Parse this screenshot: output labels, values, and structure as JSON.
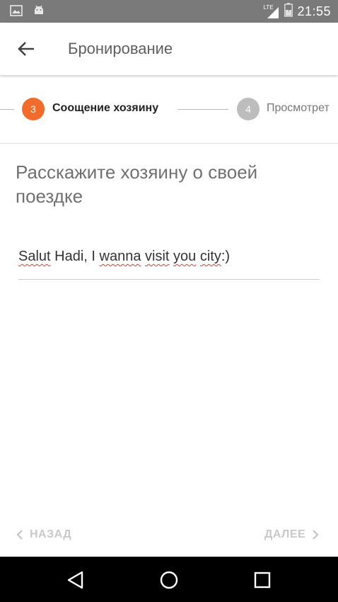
{
  "status_bar": {
    "time": "21:55",
    "network": "LTE"
  },
  "app_bar": {
    "title": "Бронирование"
  },
  "stepper": {
    "current": {
      "number": "3",
      "label": "Сооще ние хозяину"
    },
    "next": {
      "number": "4",
      "label": "Просмотрет"
    }
  },
  "content": {
    "heading": "Расскажите хозяину о своей поездке",
    "message": {
      "parts": [
        "Salut",
        " Hadi, I ",
        "wanna",
        " ",
        "visit",
        " ",
        "you",
        " ",
        "city",
        ":)"
      ]
    }
  },
  "footer": {
    "back_label": "НАЗАД",
    "next_label": "ДАЛЕЕ"
  },
  "colors": {
    "accent": "#f26b2a",
    "inactive_step": "#bdbdbd",
    "title": "#5f5f5f"
  },
  "icons": [
    "image-icon",
    "android-icon",
    "signal-icon",
    "battery-icon",
    "arrow-back-icon",
    "chevron-left-icon",
    "chevron-right-icon",
    "nav-back-icon",
    "nav-home-icon",
    "nav-recents-icon"
  ]
}
